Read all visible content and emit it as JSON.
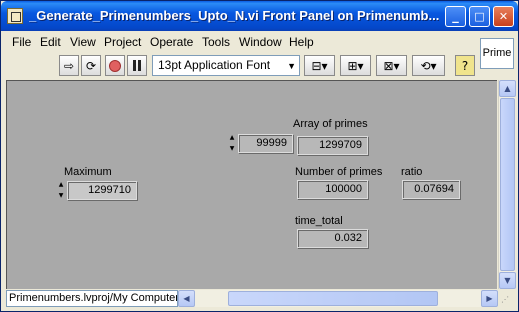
{
  "window": {
    "title": "_Generate_Primenumbers_Upto_N.vi Front Panel on Primenumb...",
    "minimize": "_",
    "maximize": "□",
    "close": "✕"
  },
  "menu": [
    "File",
    "Edit",
    "View",
    "Project",
    "Operate",
    "Tools",
    "Window",
    "Help"
  ],
  "prime_label": "Prime",
  "toolbar": {
    "font": "13pt Application Font",
    "help": "?"
  },
  "panel": {
    "array_index": "99999",
    "array_label": "Array of primes",
    "array_value": "1299709",
    "maximum_label": "Maximum",
    "maximum_value": "1299710",
    "num_primes_label": "Number of primes",
    "num_primes_value": "100000",
    "ratio_label": "ratio",
    "ratio_value": "0.07694",
    "time_label": "time_total",
    "time_value": "0.032"
  },
  "status": "Primenumbers.lvproj/My Computer",
  "colors": {
    "panel": "#a9a9a9",
    "titlebar": "#0858e0"
  }
}
